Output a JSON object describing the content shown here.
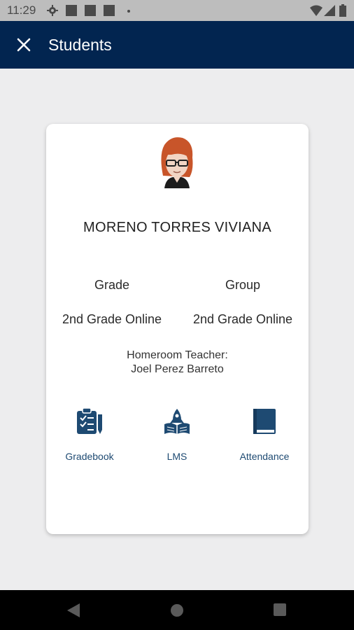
{
  "status_bar": {
    "time": "11:29"
  },
  "app_bar": {
    "title": "Students"
  },
  "student": {
    "name": "MORENO TORRES VIVIANA",
    "grade_label": "Grade",
    "group_label": "Group",
    "grade_value": "2nd Grade Online",
    "group_value": "2nd Grade Online",
    "teacher_label": "Homeroom Teacher:",
    "teacher_name": "Joel Perez Barreto"
  },
  "actions": [
    {
      "label": "Gradebook",
      "icon": "clipboard-checklist-icon"
    },
    {
      "label": "LMS",
      "icon": "rocket-book-icon"
    },
    {
      "label": "Attendance",
      "icon": "book-icon"
    }
  ],
  "colors": {
    "app_bar": "#022550",
    "accent": "#1e4a72",
    "background": "#ededee",
    "avatar_hair": "#c8552a"
  }
}
